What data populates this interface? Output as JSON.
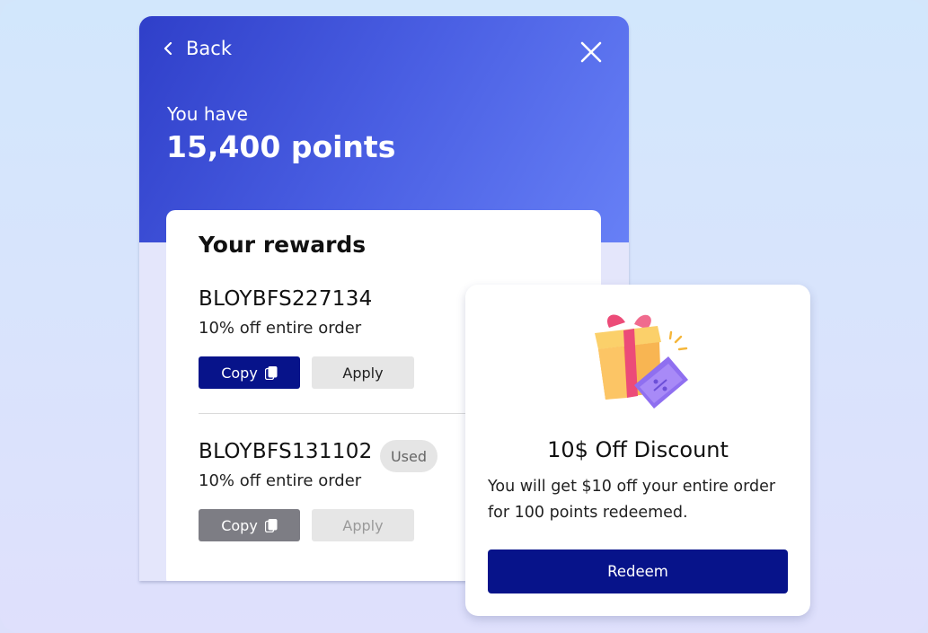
{
  "header": {
    "back_label": "Back",
    "you_have": "You have",
    "points": "15,400 points"
  },
  "rewards": {
    "title": "Your rewards",
    "items": [
      {
        "code": "BLOYBFS227134",
        "description": "10% off entire order",
        "copy_label": "Copy",
        "apply_label": "Apply",
        "status": "active"
      },
      {
        "code": "BLOYBFS131102",
        "description": "10% off entire order",
        "copy_label": "Copy",
        "apply_label": "Apply",
        "status": "used",
        "badge": "Used"
      }
    ]
  },
  "discount": {
    "title": "10$ Off Discount",
    "text": "You will get $10 off your entire order for 100 points redeemed.",
    "redeem_label": "Redeem",
    "illustration": "gift-voucher-icon"
  },
  "colors": {
    "primary": "#07138a",
    "header_start": "#2f3fc9",
    "header_end": "#6780f6",
    "disabled": "#7d7d84"
  }
}
